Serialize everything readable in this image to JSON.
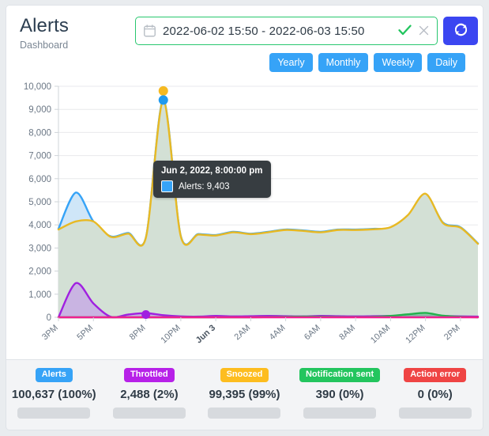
{
  "header": {
    "title": "Alerts",
    "subtitle": "Dashboard",
    "calendar_icon": "calendar-icon",
    "refresh_icon": "refresh-icon",
    "datepicker": {
      "value": "2022-06-02 15:50 - 2022-06-03 15:50",
      "placeholder": "Select date range",
      "confirm_icon": "check-icon",
      "clear_icon": "close-icon"
    },
    "range_buttons": [
      {
        "label": "Yearly",
        "active": false
      },
      {
        "label": "Monthly",
        "active": false
      },
      {
        "label": "Weekly",
        "active": false
      },
      {
        "label": "Daily",
        "active": true
      }
    ]
  },
  "tooltip": {
    "title": "Jun 2, 2022, 8:00:00 pm",
    "series_label": "Alerts: 9,403",
    "swatch_color": "#36a3f7"
  },
  "footer": {
    "stats": [
      {
        "name": "Alerts",
        "badge_color": "#36a3f7",
        "value": "100,637 (100%)",
        "percent": 100,
        "fill_color": "#36a3f7"
      },
      {
        "name": "Throttled",
        "badge_color": "#b721e8",
        "value": "2,488 (2%)",
        "percent": 2,
        "fill_color": "#b721e8"
      },
      {
        "name": "Snoozed",
        "badge_color": "#fdbd1f",
        "value": "99,395 (99%)",
        "percent": 99,
        "fill_color": "#fdbd1f"
      },
      {
        "name": "Notification sent",
        "badge_color": "#23c55e",
        "value": "390 (0%)",
        "percent": 0,
        "fill_color": "#23c55e"
      },
      {
        "name": "Action error",
        "badge_color": "#ef4444",
        "value": "0 (0%)",
        "percent": 0,
        "fill_color": "#ef4444"
      }
    ]
  },
  "chart_data": {
    "type": "area",
    "title": "",
    "xlabel": "",
    "ylabel": "",
    "ylim": [
      0,
      10000
    ],
    "yticks": [
      "0",
      "1,000",
      "2,000",
      "3,000",
      "4,000",
      "5,000",
      "6,000",
      "7,000",
      "8,000",
      "9,000",
      "10,000"
    ],
    "grid": true,
    "legend": "below-chart",
    "xticks": [
      "3PM",
      "5PM",
      "8PM",
      "10PM",
      "Jun 3",
      "2AM",
      "4AM",
      "6AM",
      "8AM",
      "10AM",
      "12PM",
      "2PM"
    ],
    "xtick_bold": [
      "Jun 3"
    ],
    "x": [
      "3PM",
      "4PM",
      "5PM",
      "6PM",
      "7PM",
      "8PM",
      "9PM",
      "10PM",
      "11PM",
      "Jun 3",
      "1AM",
      "2AM",
      "3AM",
      "4AM",
      "5AM",
      "6AM",
      "7AM",
      "8AM",
      "9AM",
      "10AM",
      "11AM",
      "12PM",
      "1PM",
      "2PM",
      "3PM"
    ],
    "series": [
      {
        "name": "Alerts",
        "color": "#36a3f7",
        "fill": "#cfe6f8",
        "values": [
          3830,
          5400,
          4150,
          3500,
          3650,
          3450,
          9403,
          3520,
          3600,
          3560,
          3700,
          3620,
          3700,
          3800,
          3760,
          3700,
          3800,
          3800,
          3830,
          3880,
          4400,
          5320,
          4100,
          3900,
          3200
        ]
      },
      {
        "name": "Snoozed",
        "color": "#e8b923",
        "fill": "#d3e0d5",
        "values": [
          3800,
          4150,
          4150,
          3480,
          3620,
          3440,
          9360,
          3500,
          3580,
          3540,
          3680,
          3600,
          3680,
          3780,
          3740,
          3680,
          3780,
          3780,
          3810,
          3900,
          4430,
          5350,
          4080,
          3880,
          3180
        ]
      },
      {
        "name": "Throttled",
        "color": "#a020e0",
        "fill": "#c9b4e2",
        "values": [
          0,
          1480,
          600,
          20,
          120,
          180,
          90,
          40,
          30,
          60,
          40,
          50,
          60,
          50,
          40,
          60,
          50,
          40,
          50,
          60,
          70,
          80,
          60,
          40,
          30
        ]
      },
      {
        "name": "Notification sent",
        "color": "#23b14d",
        "fill": "#7fd49b",
        "values": [
          0,
          0,
          0,
          0,
          0,
          0,
          0,
          0,
          0,
          0,
          0,
          0,
          10,
          20,
          30,
          25,
          15,
          10,
          20,
          60,
          130,
          190,
          70,
          20,
          0
        ]
      },
      {
        "name": "Action error",
        "color": "#f02090",
        "fill": "#f7a0cb",
        "values": [
          0,
          0,
          0,
          0,
          0,
          0,
          0,
          0,
          0,
          0,
          0,
          0,
          0,
          0,
          0,
          0,
          0,
          0,
          0,
          0,
          0,
          0,
          0,
          0,
          0
        ]
      }
    ],
    "highlight_point": {
      "x_label": "9PM",
      "value": 9403,
      "series": "Alerts"
    },
    "highlight_point_secondary": {
      "x_label": "9PM",
      "value": 9800,
      "series": "Snoozed"
    },
    "highlight_point_throttled": {
      "x_label": "8PM",
      "value": 120,
      "series": "Throttled"
    }
  }
}
